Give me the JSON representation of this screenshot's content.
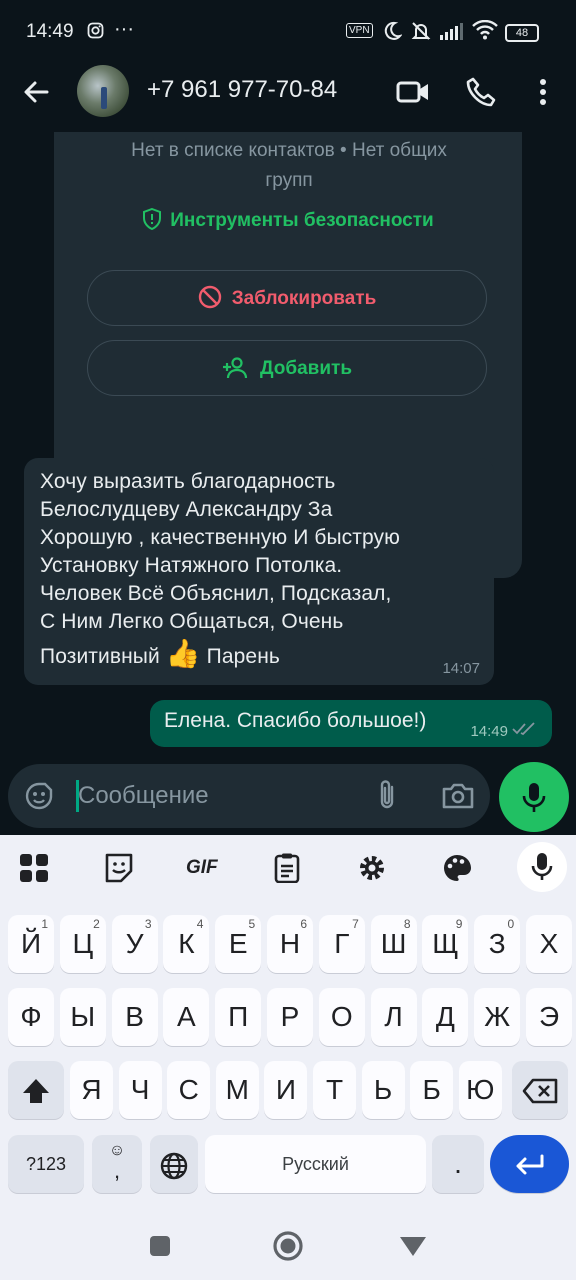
{
  "status_bar": {
    "time": "14:49",
    "more": "···",
    "vpn": "VPN",
    "battery": "48"
  },
  "header": {
    "contact": "+7 961 977-70-84"
  },
  "card": {
    "info_line1": "Нет в списке контактов • Нет общих",
    "info_line2": "групп",
    "safety_tools": "Инструменты безопасности",
    "block_label": "Заблокировать",
    "add_label": "Добавить"
  },
  "messages": {
    "incoming": {
      "lines": [
        "Хочу выразить благодарность",
        "Белослудцеву Александру За",
        "Хорошую , качественную И быструю",
        "Установку Натяжного Потолка.",
        "Человек Всё Объяснил, Подсказал,",
        "С Ним Легко Общаться, Очень"
      ],
      "last_line_before": "Позитивный",
      "emoji": "👍",
      "last_line_after": "Парень",
      "time": "14:07"
    },
    "outgoing": {
      "text": "Елена. Спасибо большое!)",
      "time": "14:49"
    }
  },
  "composer": {
    "placeholder": "Сообщение"
  },
  "keyboard": {
    "toolbar": {
      "gif": "GIF"
    },
    "row1": [
      {
        "k": "Й",
        "s": "1"
      },
      {
        "k": "Ц",
        "s": "2"
      },
      {
        "k": "У",
        "s": "3"
      },
      {
        "k": "К",
        "s": "4"
      },
      {
        "k": "Е",
        "s": "5"
      },
      {
        "k": "Н",
        "s": "6"
      },
      {
        "k": "Г",
        "s": "7"
      },
      {
        "k": "Ш",
        "s": "8"
      },
      {
        "k": "Щ",
        "s": "9"
      },
      {
        "k": "З",
        "s": "0"
      },
      {
        "k": "Х",
        "s": ""
      }
    ],
    "row2": [
      "Ф",
      "Ы",
      "В",
      "А",
      "П",
      "Р",
      "О",
      "Л",
      "Д",
      "Ж",
      "Э"
    ],
    "row3": [
      "Я",
      "Ч",
      "С",
      "М",
      "И",
      "Т",
      "Ь",
      "Б",
      "Ю"
    ],
    "symbols_key": "?123",
    "emoji_key": "☺",
    "comma_key": ",",
    "space_label": "Русский",
    "period_key": "."
  }
}
